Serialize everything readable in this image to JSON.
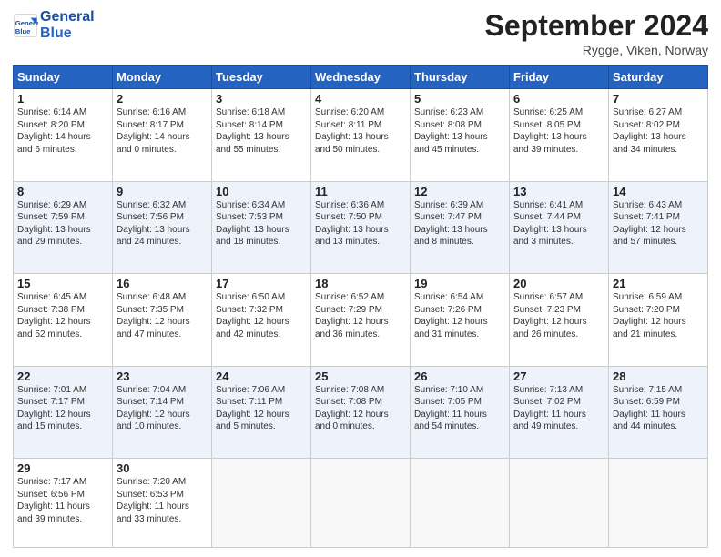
{
  "header": {
    "logo_line1": "General",
    "logo_line2": "Blue",
    "month": "September 2024",
    "location": "Rygge, Viken, Norway"
  },
  "days_of_week": [
    "Sunday",
    "Monday",
    "Tuesday",
    "Wednesday",
    "Thursday",
    "Friday",
    "Saturday"
  ],
  "weeks": [
    [
      {
        "day": "1",
        "lines": [
          "Sunrise: 6:14 AM",
          "Sunset: 8:20 PM",
          "Daylight: 14 hours",
          "and 6 minutes."
        ]
      },
      {
        "day": "2",
        "lines": [
          "Sunrise: 6:16 AM",
          "Sunset: 8:17 PM",
          "Daylight: 14 hours",
          "and 0 minutes."
        ]
      },
      {
        "day": "3",
        "lines": [
          "Sunrise: 6:18 AM",
          "Sunset: 8:14 PM",
          "Daylight: 13 hours",
          "and 55 minutes."
        ]
      },
      {
        "day": "4",
        "lines": [
          "Sunrise: 6:20 AM",
          "Sunset: 8:11 PM",
          "Daylight: 13 hours",
          "and 50 minutes."
        ]
      },
      {
        "day": "5",
        "lines": [
          "Sunrise: 6:23 AM",
          "Sunset: 8:08 PM",
          "Daylight: 13 hours",
          "and 45 minutes."
        ]
      },
      {
        "day": "6",
        "lines": [
          "Sunrise: 6:25 AM",
          "Sunset: 8:05 PM",
          "Daylight: 13 hours",
          "and 39 minutes."
        ]
      },
      {
        "day": "7",
        "lines": [
          "Sunrise: 6:27 AM",
          "Sunset: 8:02 PM",
          "Daylight: 13 hours",
          "and 34 minutes."
        ]
      }
    ],
    [
      {
        "day": "8",
        "lines": [
          "Sunrise: 6:29 AM",
          "Sunset: 7:59 PM",
          "Daylight: 13 hours",
          "and 29 minutes."
        ]
      },
      {
        "day": "9",
        "lines": [
          "Sunrise: 6:32 AM",
          "Sunset: 7:56 PM",
          "Daylight: 13 hours",
          "and 24 minutes."
        ]
      },
      {
        "day": "10",
        "lines": [
          "Sunrise: 6:34 AM",
          "Sunset: 7:53 PM",
          "Daylight: 13 hours",
          "and 18 minutes."
        ]
      },
      {
        "day": "11",
        "lines": [
          "Sunrise: 6:36 AM",
          "Sunset: 7:50 PM",
          "Daylight: 13 hours",
          "and 13 minutes."
        ]
      },
      {
        "day": "12",
        "lines": [
          "Sunrise: 6:39 AM",
          "Sunset: 7:47 PM",
          "Daylight: 13 hours",
          "and 8 minutes."
        ]
      },
      {
        "day": "13",
        "lines": [
          "Sunrise: 6:41 AM",
          "Sunset: 7:44 PM",
          "Daylight: 13 hours",
          "and 3 minutes."
        ]
      },
      {
        "day": "14",
        "lines": [
          "Sunrise: 6:43 AM",
          "Sunset: 7:41 PM",
          "Daylight: 12 hours",
          "and 57 minutes."
        ]
      }
    ],
    [
      {
        "day": "15",
        "lines": [
          "Sunrise: 6:45 AM",
          "Sunset: 7:38 PM",
          "Daylight: 12 hours",
          "and 52 minutes."
        ]
      },
      {
        "day": "16",
        "lines": [
          "Sunrise: 6:48 AM",
          "Sunset: 7:35 PM",
          "Daylight: 12 hours",
          "and 47 minutes."
        ]
      },
      {
        "day": "17",
        "lines": [
          "Sunrise: 6:50 AM",
          "Sunset: 7:32 PM",
          "Daylight: 12 hours",
          "and 42 minutes."
        ]
      },
      {
        "day": "18",
        "lines": [
          "Sunrise: 6:52 AM",
          "Sunset: 7:29 PM",
          "Daylight: 12 hours",
          "and 36 minutes."
        ]
      },
      {
        "day": "19",
        "lines": [
          "Sunrise: 6:54 AM",
          "Sunset: 7:26 PM",
          "Daylight: 12 hours",
          "and 31 minutes."
        ]
      },
      {
        "day": "20",
        "lines": [
          "Sunrise: 6:57 AM",
          "Sunset: 7:23 PM",
          "Daylight: 12 hours",
          "and 26 minutes."
        ]
      },
      {
        "day": "21",
        "lines": [
          "Sunrise: 6:59 AM",
          "Sunset: 7:20 PM",
          "Daylight: 12 hours",
          "and 21 minutes."
        ]
      }
    ],
    [
      {
        "day": "22",
        "lines": [
          "Sunrise: 7:01 AM",
          "Sunset: 7:17 PM",
          "Daylight: 12 hours",
          "and 15 minutes."
        ]
      },
      {
        "day": "23",
        "lines": [
          "Sunrise: 7:04 AM",
          "Sunset: 7:14 PM",
          "Daylight: 12 hours",
          "and 10 minutes."
        ]
      },
      {
        "day": "24",
        "lines": [
          "Sunrise: 7:06 AM",
          "Sunset: 7:11 PM",
          "Daylight: 12 hours",
          "and 5 minutes."
        ]
      },
      {
        "day": "25",
        "lines": [
          "Sunrise: 7:08 AM",
          "Sunset: 7:08 PM",
          "Daylight: 12 hours",
          "and 0 minutes."
        ]
      },
      {
        "day": "26",
        "lines": [
          "Sunrise: 7:10 AM",
          "Sunset: 7:05 PM",
          "Daylight: 11 hours",
          "and 54 minutes."
        ]
      },
      {
        "day": "27",
        "lines": [
          "Sunrise: 7:13 AM",
          "Sunset: 7:02 PM",
          "Daylight: 11 hours",
          "and 49 minutes."
        ]
      },
      {
        "day": "28",
        "lines": [
          "Sunrise: 7:15 AM",
          "Sunset: 6:59 PM",
          "Daylight: 11 hours",
          "and 44 minutes."
        ]
      }
    ],
    [
      {
        "day": "29",
        "lines": [
          "Sunrise: 7:17 AM",
          "Sunset: 6:56 PM",
          "Daylight: 11 hours",
          "and 39 minutes."
        ]
      },
      {
        "day": "30",
        "lines": [
          "Sunrise: 7:20 AM",
          "Sunset: 6:53 PM",
          "Daylight: 11 hours",
          "and 33 minutes."
        ]
      },
      {
        "day": "",
        "lines": []
      },
      {
        "day": "",
        "lines": []
      },
      {
        "day": "",
        "lines": []
      },
      {
        "day": "",
        "lines": []
      },
      {
        "day": "",
        "lines": []
      }
    ]
  ]
}
